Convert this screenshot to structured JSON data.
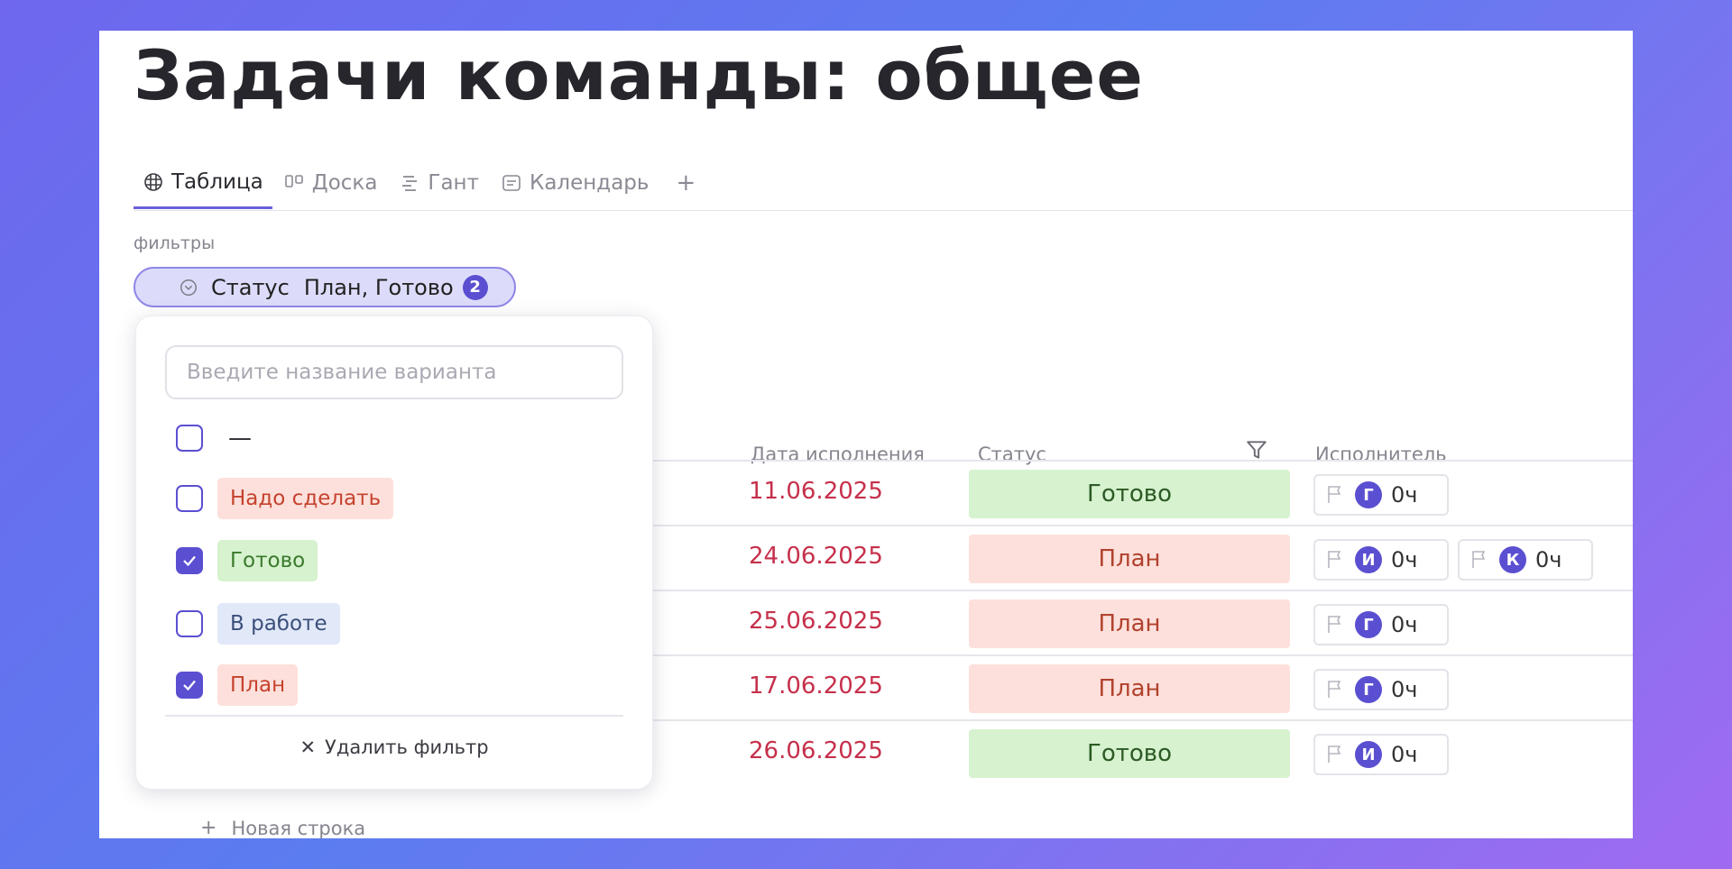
{
  "title": "Задачи команды: общее",
  "tabs": [
    {
      "label": "Таблица",
      "icon": "table-icon",
      "active": true
    },
    {
      "label": "Доска",
      "icon": "board-icon",
      "active": false
    },
    {
      "label": "Гант",
      "icon": "gantt-icon",
      "active": false
    },
    {
      "label": "Календарь",
      "icon": "calendar-icon",
      "active": false
    }
  ],
  "add_tab_label": "+",
  "filters": {
    "label": "фильтры",
    "chip": {
      "name": "Статус",
      "values": "План, Готово",
      "count": "2"
    },
    "dropdown": {
      "search_placeholder": "Введите название варианта",
      "options": [
        {
          "label": "—",
          "checked": false,
          "color": "none"
        },
        {
          "label": "Надо сделать",
          "checked": false,
          "color": "red"
        },
        {
          "label": "Готово",
          "checked": true,
          "color": "green"
        },
        {
          "label": "В работе",
          "checked": false,
          "color": "blue"
        },
        {
          "label": "План",
          "checked": true,
          "color": "red"
        }
      ],
      "remove_label": "Удалить фильтр"
    }
  },
  "table": {
    "columns": {
      "due": "Дата исполнения",
      "status": "Статус",
      "assignee": "Исполнитель"
    },
    "rows": [
      {
        "date": "11.06.2025",
        "status": "Готово",
        "assignees": [
          {
            "initial": "Г",
            "hours": "0ч"
          }
        ]
      },
      {
        "date": "24.06.2025",
        "status": "План",
        "assignees": [
          {
            "initial": "И",
            "hours": "0ч"
          },
          {
            "initial": "К",
            "hours": "0ч"
          }
        ]
      },
      {
        "date": "25.06.2025",
        "status": "План",
        "assignees": [
          {
            "initial": "Г",
            "hours": "0ч"
          }
        ]
      },
      {
        "date": "17.06.2025",
        "status": "План",
        "assignees": [
          {
            "initial": "Г",
            "hours": "0ч"
          }
        ]
      },
      {
        "date": "26.06.2025",
        "status": "Готово",
        "assignees": [
          {
            "initial": "И",
            "hours": "0ч"
          }
        ]
      }
    ],
    "new_row_label": "Новая строка"
  },
  "colors": {
    "accent": "#5b4fd1",
    "date": "#c6304b",
    "status_done_bg": "#d6f2cf",
    "status_plan_bg": "#fde0db"
  }
}
